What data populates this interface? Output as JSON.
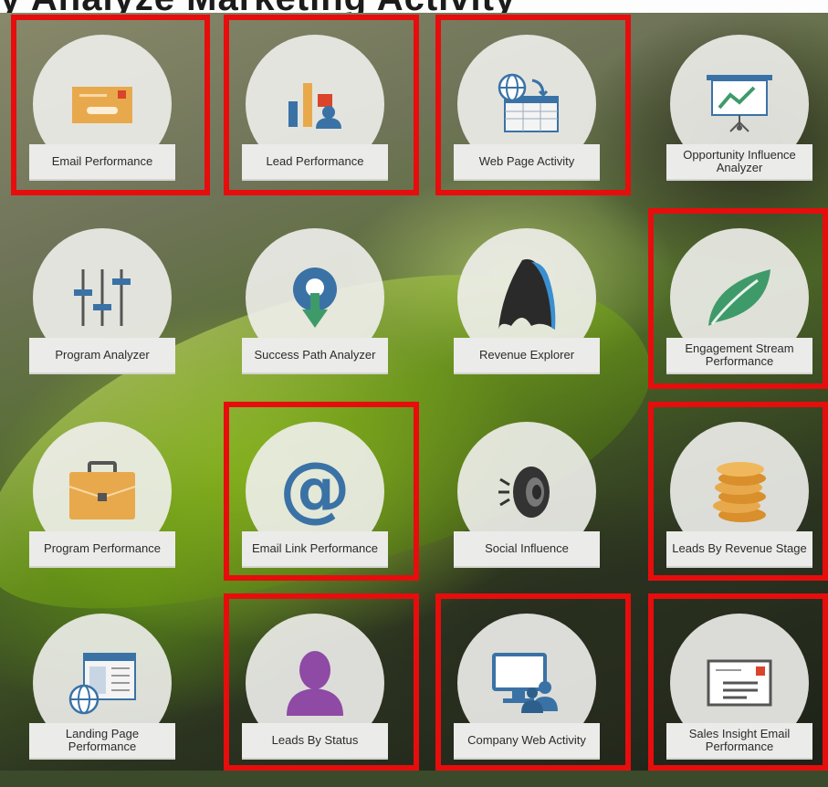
{
  "header_partial_text": "y Analyze Marketing Activity",
  "tiles": [
    {
      "label": "Email Performance",
      "icon": "envelope-icon",
      "highlighted": true
    },
    {
      "label": "Lead Performance",
      "icon": "bar-chart-person-icon",
      "highlighted": true
    },
    {
      "label": "Web Page Activity",
      "icon": "web-page-globe-icon",
      "highlighted": true
    },
    {
      "label": "Opportunity Influence Analyzer",
      "icon": "presentation-board-icon",
      "highlighted": false
    },
    {
      "label": "Program Analyzer",
      "icon": "sliders-icon",
      "highlighted": false
    },
    {
      "label": "Success Path Analyzer",
      "icon": "success-path-icon",
      "highlighted": false
    },
    {
      "label": "Revenue Explorer",
      "icon": "revenue-explorer-icon",
      "highlighted": false
    },
    {
      "label": "Engagement Stream Performance",
      "icon": "leaf-icon",
      "highlighted": true
    },
    {
      "label": "Program Performance",
      "icon": "briefcase-icon",
      "highlighted": false
    },
    {
      "label": "Email Link Performance",
      "icon": "at-sign-icon",
      "highlighted": true
    },
    {
      "label": "Social Influence",
      "icon": "speaker-icon",
      "highlighted": false
    },
    {
      "label": "Leads By Revenue Stage",
      "icon": "coin-stack-icon",
      "highlighted": true
    },
    {
      "label": "Landing Page Performance",
      "icon": "landing-page-icon",
      "highlighted": false
    },
    {
      "label": "Leads By Status",
      "icon": "person-icon",
      "highlighted": true
    },
    {
      "label": "Company Web Activity",
      "icon": "monitor-people-icon",
      "highlighted": true
    },
    {
      "label": "Sales Insight Email Performance",
      "icon": "letter-icon",
      "highlighted": true
    }
  ],
  "colors": {
    "highlight": "#e60d0d",
    "orange": "#e8a94c",
    "blue": "#3a72a6",
    "green": "#3f9a6a",
    "purple": "#8e4aa5"
  }
}
